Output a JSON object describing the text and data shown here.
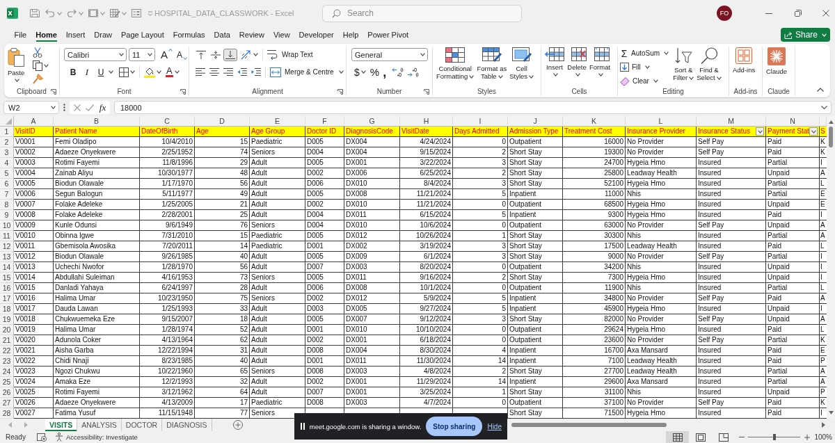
{
  "title_bar": {
    "title": "HOSPITAL_DATA_CLASSWORK - Excel",
    "search": {
      "placeholder": "Search"
    },
    "account": "FO"
  },
  "menu": [
    {
      "label": "File",
      "selected": false
    },
    {
      "label": "Home",
      "selected": true
    },
    {
      "label": "Insert",
      "selected": false
    },
    {
      "label": "Draw",
      "selected": false
    },
    {
      "label": "Page Layout",
      "selected": false
    },
    {
      "label": "Formulas",
      "selected": false
    },
    {
      "label": "Data",
      "selected": false
    },
    {
      "label": "Review",
      "selected": false
    },
    {
      "label": "View",
      "selected": false
    },
    {
      "label": "Developer",
      "selected": false
    },
    {
      "label": "Help",
      "selected": false
    },
    {
      "label": "Power Pivot",
      "selected": false
    }
  ],
  "share": "Share",
  "ribbon": {
    "clipboard": {
      "label": "Clipboard",
      "paste": "Paste"
    },
    "font": {
      "label": "Font",
      "name": "Calibri",
      "size": "11",
      "grow": "A",
      "shrink": "A",
      "bold": "B",
      "italic": "I",
      "underline": "U",
      "font_color": "A"
    },
    "alignment": {
      "label": "Alignment",
      "vertical_align": [
        {
          "kind": "top",
          "selected": false
        },
        {
          "kind": "middle",
          "selected": false
        },
        {
          "kind": "bottom",
          "selected": true
        }
      ],
      "wrap_text": "Wrap Text",
      "merge": "Merge & Centre"
    },
    "number": {
      "label": "Number",
      "format": "General",
      "currency": "$",
      "percent": "%",
      "comma": ","
    },
    "styles": {
      "label": "Styles",
      "conditional_formatting": "Conditional\nFormatting",
      "format_as_table": "Format as\nTable",
      "cell_styles": "Cell\nStyles"
    },
    "cells": {
      "label": "Cells",
      "insert": "Insert",
      "delete": "Delete",
      "format": "Format"
    },
    "editing": {
      "label": "Editing",
      "autosum_symbol": "Σ",
      "autosum": "AutoSum",
      "fill": "Fill",
      "clear": "Clear",
      "sort_filter": "Sort &\nFilter",
      "find_select": "Find &\nSelect"
    },
    "add_ins": {
      "label": "Add-ins",
      "button": "Add-ins"
    },
    "claude": {
      "label": "Claude",
      "button": "Claude"
    }
  },
  "formula_bar": {
    "name_box": "W2",
    "fx": "fx",
    "value": "18000"
  },
  "sheet": {
    "columns": [
      {
        "letter": "A",
        "numeric": false
      },
      {
        "letter": "B",
        "numeric": false
      },
      {
        "letter": "C",
        "numeric": true
      },
      {
        "letter": "D",
        "numeric": true
      },
      {
        "letter": "E",
        "numeric": false
      },
      {
        "letter": "F",
        "numeric": false
      },
      {
        "letter": "G",
        "numeric": false
      },
      {
        "letter": "H",
        "numeric": true
      },
      {
        "letter": "I",
        "numeric": true
      },
      {
        "letter": "J",
        "numeric": false
      },
      {
        "letter": "K",
        "numeric": true
      },
      {
        "letter": "L",
        "numeric": false
      },
      {
        "letter": "M",
        "numeric": false
      },
      {
        "letter": "N",
        "numeric": false
      },
      {
        "numeric": false
      }
    ],
    "header": {
      "n": "1",
      "cells": [
        {
          "text": "VisitID",
          "filter": false
        },
        {
          "text": "Patient Name",
          "filter": false
        },
        {
          "text": "DateOfBirth",
          "filter": false
        },
        {
          "text": "Age",
          "filter": false
        },
        {
          "text": "Age Group",
          "filter": false
        },
        {
          "text": "Doctor ID",
          "filter": false
        },
        {
          "text": "DiagnosisCode",
          "filter": false
        },
        {
          "text": "VisitDate",
          "filter": false
        },
        {
          "text": "Days Admitted",
          "filter": false
        },
        {
          "text": "Admission Type",
          "filter": false
        },
        {
          "text": "Treatment Cost",
          "filter": false
        },
        {
          "text": "Insurance Provider",
          "filter": false
        },
        {
          "text": "Insurance Status",
          "filter": true
        },
        {
          "text": "Payment Stat",
          "filter": true
        },
        {
          "text": "S",
          "filter": false
        }
      ]
    },
    "rows": [
      {
        "n": "2",
        "cells": [
          "V0001",
          "Femi Oladipo",
          "10/4/2010",
          "15",
          "Paediatric",
          "D005",
          "DX004",
          "4/24/2024",
          "0",
          "Outpatient",
          "16000",
          "No Provider",
          "Self Pay",
          "Paid",
          "K"
        ]
      },
      {
        "n": "3",
        "cells": [
          "V0002",
          "Adaeze Onyekwere",
          "2/25/1952",
          "74",
          "Seniors",
          "D004",
          "DX004",
          "9/15/2024",
          "2",
          "Short Stay",
          "19300",
          "No Provider",
          "Self Pay",
          "Paid",
          "K"
        ]
      },
      {
        "n": "4",
        "cells": [
          "V0003",
          "Rotimi Fayemi",
          "11/8/1996",
          "29",
          "Adult",
          "D005",
          "DX001",
          "3/22/2024",
          "3",
          "Short Stay",
          "24700",
          "Hygeia Hmo",
          "Insured",
          "Partial",
          "I"
        ]
      },
      {
        "n": "5",
        "cells": [
          "V0004",
          "Zainab Aliyu",
          "10/30/1977",
          "48",
          "Adult",
          "D002",
          "DX006",
          "6/25/2024",
          "2",
          "Short Stay",
          "25800",
          "Leadway Health",
          "Insured",
          "Unpaid",
          "A"
        ]
      },
      {
        "n": "6",
        "cells": [
          "V0005",
          "Biodun Olawale",
          "1/17/1970",
          "56",
          "Adult",
          "D006",
          "DX010",
          "8/4/2024",
          "3",
          "Short Stay",
          "52100",
          "Hygeia Hmo",
          "Insured",
          "Partial",
          "L"
        ]
      },
      {
        "n": "7",
        "cells": [
          "V0006",
          "Segun Balogun",
          "5/11/1977",
          "49",
          "Adult",
          "D005",
          "DX008",
          "11/21/2024",
          "5",
          "Inpatient",
          "11000",
          "Nhis",
          "Insured",
          "Partial",
          "E"
        ]
      },
      {
        "n": "8",
        "cells": [
          "V0007",
          "Folake Adeleke",
          "1/25/2005",
          "21",
          "Adult",
          "D002",
          "DX010",
          "11/21/2024",
          "0",
          "Outpatient",
          "68500",
          "Hygeia Hmo",
          "Insured",
          "Unpaid",
          "E"
        ]
      },
      {
        "n": "9",
        "cells": [
          "V0008",
          "Folake Adeleke",
          "2/28/2001",
          "25",
          "Adult",
          "D004",
          "DX011",
          "6/15/2024",
          "5",
          "Inpatient",
          "9300",
          "Hygeia Hmo",
          "Insured",
          "Paid",
          "I"
        ]
      },
      {
        "n": "10",
        "cells": [
          "V0009",
          "Kunle Odunsi",
          "9/6/1949",
          "76",
          "Seniors",
          "D004",
          "DX010",
          "10/6/2024",
          "0",
          "Outpatient",
          "63000",
          "No Provider",
          "Self Pay",
          "Unpaid",
          "A"
        ]
      },
      {
        "n": "11",
        "cells": [
          "V0010",
          "Obinna Igwe",
          "7/31/2010",
          "15",
          "Paediatric",
          "D005",
          "DX012",
          "10/26/2024",
          "1",
          "Short Stay",
          "30300",
          "Nhis",
          "Insured",
          "Partial",
          "A"
        ]
      },
      {
        "n": "12",
        "cells": [
          "V0011",
          "Gbemisola Awosika",
          "7/20/2011",
          "14",
          "Paediatric",
          "D001",
          "DX002",
          "3/19/2024",
          "3",
          "Short Stay",
          "17500",
          "Leadway Health",
          "Insured",
          "Paid",
          "L"
        ]
      },
      {
        "n": "13",
        "cells": [
          "V0012",
          "Biodun Olawale",
          "9/26/1985",
          "40",
          "Adult",
          "D005",
          "DX009",
          "6/1/2024",
          "3",
          "Short Stay",
          "9000",
          "No Provider",
          "Self Pay",
          "Partial",
          "I"
        ]
      },
      {
        "n": "14",
        "cells": [
          "V0013",
          "Uchechi Nwofor",
          "1/28/1970",
          "56",
          "Adult",
          "D007",
          "DX003",
          "8/20/2024",
          "0",
          "Outpatient",
          "34200",
          "Nhis",
          "Insured",
          "Unpaid",
          "I"
        ]
      },
      {
        "n": "15",
        "cells": [
          "V0014",
          "Abdullahi Suleiman",
          "4/16/1953",
          "73",
          "Seniors",
          "D005",
          "DX011",
          "9/16/2024",
          "2",
          "Short Stay",
          "7300",
          "Hygeia Hmo",
          "Insured",
          "Unpaid",
          "I"
        ]
      },
      {
        "n": "16",
        "cells": [
          "V0015",
          "Danladi Yahaya",
          "6/24/1997",
          "28",
          "Adult",
          "D006",
          "DX008",
          "10/1/2024",
          "0",
          "Outpatient",
          "11900",
          "Nhis",
          "Insured",
          "Partial",
          "L"
        ]
      },
      {
        "n": "17",
        "cells": [
          "V0016",
          "Halima Umar",
          "10/23/1950",
          "75",
          "Seniors",
          "D002",
          "DX012",
          "5/9/2024",
          "5",
          "Inpatient",
          "34800",
          "No Provider",
          "Self Pay",
          "Paid",
          "A"
        ]
      },
      {
        "n": "18",
        "cells": [
          "V0017",
          "Dauda Lawan",
          "1/25/1993",
          "33",
          "Adult",
          "D003",
          "DX005",
          "9/27/2024",
          "5",
          "Inpatient",
          "45900",
          "Hygeia Hmo",
          "Insured",
          "Unpaid",
          "I"
        ]
      },
      {
        "n": "19",
        "cells": [
          "V0018",
          "Chukwuemeka Eze",
          "9/15/2007",
          "18",
          "Adult",
          "D005",
          "DX007",
          "9/12/2024",
          "3",
          "Short Stay",
          "82000",
          "No Provider",
          "Self Pay",
          "Unpaid",
          "A"
        ]
      },
      {
        "n": "20",
        "cells": [
          "V0019",
          "Halima Umar",
          "1/28/1974",
          "52",
          "Adult",
          "D001",
          "DX010",
          "10/10/2024",
          "0",
          "Outpatient",
          "29624",
          "Hygeia Hmo",
          "Insured",
          "Paid",
          "L"
        ]
      },
      {
        "n": "21",
        "cells": [
          "V0020",
          "Adunola Coker",
          "4/13/1964",
          "62",
          "Adult",
          "D002",
          "DX001",
          "6/18/2024",
          "0",
          "Outpatient",
          "23600",
          "No Provider",
          "Self Pay",
          "Partial",
          "K"
        ]
      },
      {
        "n": "22",
        "cells": [
          "V0021",
          "Aisha Garba",
          "12/22/1994",
          "31",
          "Adult",
          "D008",
          "DX004",
          "8/30/2024",
          "4",
          "Inpatient",
          "16700",
          "Axa Mansard",
          "Insured",
          "Paid",
          "E"
        ]
      },
      {
        "n": "23",
        "cells": [
          "V0022",
          "Chidi Nnaji",
          "8/23/1985",
          "40",
          "Adult",
          "D001",
          "DX011",
          "11/30/2024",
          "14",
          "Inpatient",
          "7100",
          "Leadway Health",
          "Insured",
          "Paid",
          "P"
        ]
      },
      {
        "n": "24",
        "cells": [
          "V0023",
          "Ngozi Chukwu",
          "10/22/1960",
          "65",
          "Seniors",
          "D008",
          "DX003",
          "4/8/2024",
          "2",
          "Short Stay",
          "27700",
          "Leadway Health",
          "Insured",
          "Partial",
          "A"
        ]
      },
      {
        "n": "25",
        "cells": [
          "V0024",
          "Amaka Eze",
          "12/2/1993",
          "32",
          "Adult",
          "D002",
          "DX001",
          "11/29/2024",
          "14",
          "Inpatient",
          "29600",
          "Axa Mansard",
          "Insured",
          "Partial",
          "A"
        ]
      },
      {
        "n": "26",
        "cells": [
          "V0025",
          "Rotimi Fayemi",
          "3/12/1962",
          "64",
          "Adult",
          "D007",
          "DX001",
          "3/25/2024",
          "1",
          "Short Stay",
          "31100",
          "Nhis",
          "Insured",
          "Unpaid",
          "P"
        ]
      },
      {
        "n": "27",
        "cells": [
          "V0026",
          "Adaeze Onyekwere",
          "4/13/2009",
          "17",
          "Paediatric",
          "D008",
          "DX003",
          "4/7/2024",
          "0",
          "Outpatient",
          "37100",
          "No Provider",
          "Self Pay",
          "Paid",
          "K"
        ]
      },
      {
        "n": "28",
        "cells": [
          "V0027",
          "Fatima Yusuf",
          "11/15/1948",
          "77",
          "Seniors",
          null,
          null,
          null,
          null,
          "Short Stay",
          "71500",
          "Hygeia Hmo",
          "Insured",
          "Paid",
          "I"
        ]
      }
    ]
  },
  "sheet_tabs": [
    {
      "label": "VISITS",
      "selected": true
    },
    {
      "label": "ANALYSIS",
      "selected": false
    },
    {
      "label": "DOCTOR",
      "selected": false
    },
    {
      "label": "DIAGNOSIS",
      "selected": false
    }
  ],
  "status_bar": {
    "status": "Ready",
    "accessibility": "Accessibility: Investigate",
    "views": [
      {
        "kind": "normal",
        "selected": true
      },
      {
        "kind": "page_layout",
        "selected": false
      },
      {
        "kind": "page_break",
        "selected": false
      }
    ],
    "zoom": {
      "level": 0.5,
      "reading": "100%"
    }
  },
  "screen_share": {
    "message": "meet.google.com is sharing a window.",
    "stop": "Stop sharing",
    "hide": "Hide"
  }
}
